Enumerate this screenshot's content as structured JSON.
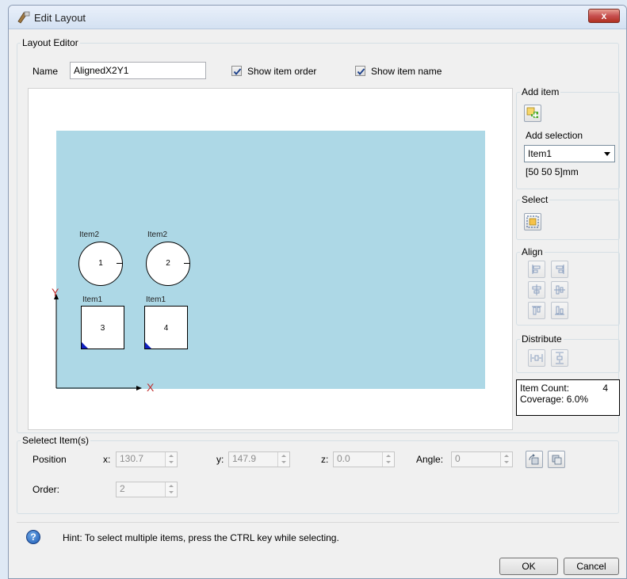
{
  "window": {
    "title": "Edit Layout",
    "close_symbol": "x"
  },
  "layout_editor": {
    "group_label": "Layout Editor",
    "name_label": "Name",
    "name_value": "AlignedX2Y1",
    "show_item_order_label": "Show item order",
    "show_item_order_checked": true,
    "show_item_name_label": "Show item name",
    "show_item_name_checked": true
  },
  "canvas": {
    "background_color": "#add8e6",
    "items": [
      {
        "name": "Item2",
        "order": "1",
        "shape": "circle"
      },
      {
        "name": "Item2",
        "order": "2",
        "shape": "circle"
      },
      {
        "name": "Item1",
        "order": "3",
        "shape": "square"
      },
      {
        "name": "Item1",
        "order": "4",
        "shape": "square"
      }
    ],
    "axis_x": "X",
    "axis_y": "Y"
  },
  "add_item": {
    "group_label": "Add item",
    "add_icon": "add-item-icon",
    "add_selection_label": "Add selection",
    "selected_item": "Item1",
    "dimensions": "[50 50 5]mm"
  },
  "select": {
    "group_label": "Select",
    "select_icon": "select-all-icon"
  },
  "align": {
    "group_label": "Align",
    "buttons": [
      "align-left-icon",
      "align-right-icon",
      "align-center-vertical-icon",
      "align-center-horizontal-icon",
      "align-top-icon",
      "align-bottom-icon"
    ]
  },
  "distribute": {
    "group_label": "Distribute",
    "buttons": [
      "distribute-horizontal-icon",
      "distribute-vertical-icon"
    ]
  },
  "stats": {
    "item_count_label": "Item Count:",
    "item_count_value": "4",
    "coverage_label": "Coverage:",
    "coverage_value": "6.0%"
  },
  "selected_items": {
    "group_label": "Seletect Item(s)",
    "position_label": "Position",
    "x_label": "x:",
    "x_value": "130.7",
    "y_label": "y:",
    "y_value": "147.9",
    "z_label": "z:",
    "z_value": "0.0",
    "angle_label": "Angle:",
    "angle_value": "0",
    "order_label": "Order:",
    "order_value": "2"
  },
  "hint": {
    "icon": "help-icon",
    "text": "Hint: To select multiple items, press the CTRL key while selecting."
  },
  "footer": {
    "ok_label": "OK",
    "cancel_label": "Cancel"
  }
}
